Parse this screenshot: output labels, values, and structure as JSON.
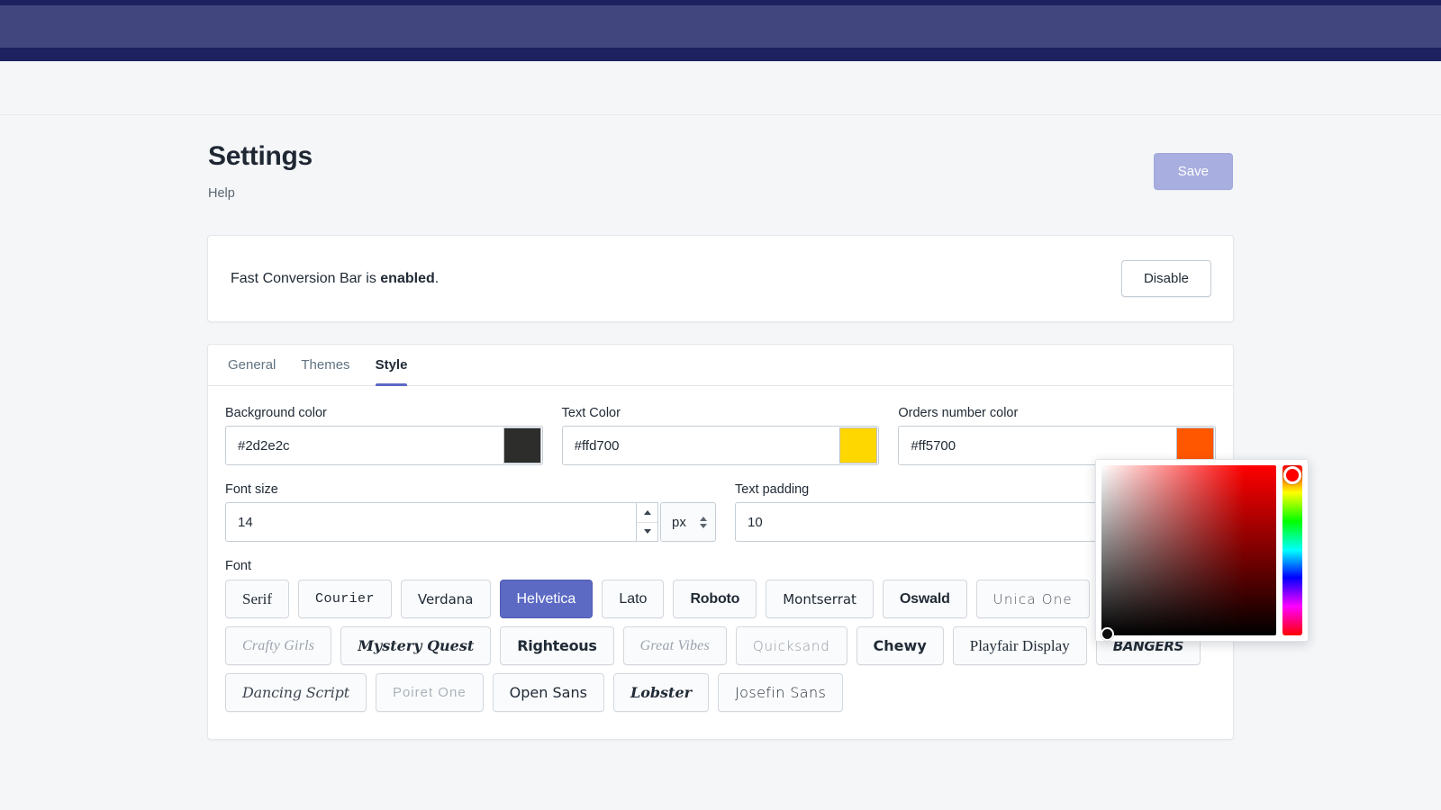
{
  "chrome": {
    "bar_color_dark": "#1e2160",
    "bar_color_main": "#41477e"
  },
  "header": {
    "title": "Settings",
    "help_label": "Help",
    "save_label": "Save",
    "save_color": "#a8aedf"
  },
  "banner": {
    "text_before": "Fast Conversion Bar is ",
    "text_bold": "enabled",
    "text_after": ".",
    "action_label": "Disable"
  },
  "tabs": [
    {
      "label": "General",
      "active": false
    },
    {
      "label": "Themes",
      "active": false
    },
    {
      "label": "Style",
      "active": true
    }
  ],
  "accent_color": "#5c6ac4",
  "fields": {
    "background_color": {
      "label": "Background color",
      "value": "#2d2e2c",
      "swatch": "#2d2e2c"
    },
    "text_color": {
      "label": "Text Color",
      "value": "#ffd700",
      "swatch": "#ffd700"
    },
    "orders_number_color": {
      "label": "Orders number color",
      "value": "#ff5700",
      "swatch": "#ff5700"
    },
    "font_size": {
      "label": "Font size",
      "value": "14",
      "unit": "px"
    },
    "text_padding": {
      "label": "Text padding",
      "value": "10"
    }
  },
  "font_picker": {
    "label": "Font",
    "selected": "Helvetica",
    "rows": [
      [
        {
          "name": "Serif",
          "style": "f-serif"
        },
        {
          "name": "Courier",
          "style": "f-mono"
        },
        {
          "name": "Verdana",
          "style": "f-sans"
        },
        {
          "name": "Helvetica",
          "style": "f-sans-lib"
        },
        {
          "name": "Lato",
          "style": "f-sans-lib"
        },
        {
          "name": "Roboto",
          "style": "f-cond-bold"
        },
        {
          "name": "Montserrat",
          "style": "f-sans"
        },
        {
          "name": "Oswald",
          "style": "f-cond-bold"
        },
        {
          "name": "Unica One",
          "style": "f-wide-thin"
        }
      ],
      [
        {
          "name": "Crafty Girls",
          "style": "f-script-lite"
        },
        {
          "name": "Mystery Quest",
          "style": "f-hand"
        },
        {
          "name": "Righteous",
          "style": "f-display"
        },
        {
          "name": "Great Vibes",
          "style": "f-script-lite"
        },
        {
          "name": "Quicksand",
          "style": "f-round-thin"
        },
        {
          "name": "Chewy",
          "style": "f-chunky"
        },
        {
          "name": "Playfair Display",
          "style": "f-playfair"
        },
        {
          "name": "BANGERS",
          "style": "f-bangers"
        }
      ],
      [
        {
          "name": "Dancing Script",
          "style": "f-script"
        },
        {
          "name": "Poiret One",
          "style": "f-light-caps"
        },
        {
          "name": "Open Sans",
          "style": "f-opensans"
        },
        {
          "name": "Lobster",
          "style": "f-lobster"
        },
        {
          "name": "Josefin Sans",
          "style": "f-josefin"
        }
      ]
    ]
  },
  "color_picker": {
    "open": true,
    "hue": "#ff0000",
    "selected_color": "#000000"
  }
}
